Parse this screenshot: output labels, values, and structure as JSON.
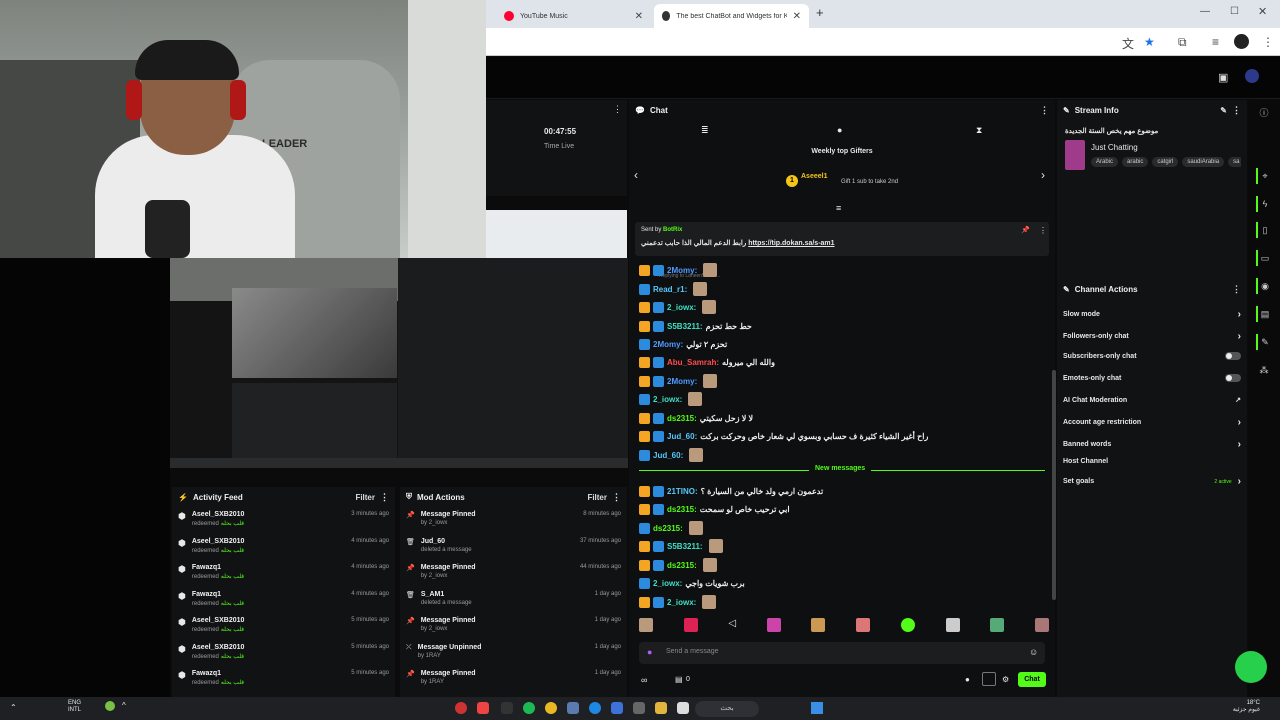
{
  "browser": {
    "tabs": [
      {
        "label": "YouTube Music",
        "active": false
      },
      {
        "label": "The best ChatBot and Widgets for Kick. Fe",
        "active": true
      }
    ],
    "new_tab": "+"
  },
  "timer": {
    "value": "00:47:55",
    "label": "Time Live"
  },
  "chat": {
    "title": "Chat",
    "gifters_title": "Weekly top Gifters",
    "gifter_rank": "1",
    "gifter_name": "Aseeel1",
    "gifter_note": "Gift 1 sub to take 2nd",
    "pinned_by_label": "Sent by",
    "pinned_by_name": "BotRix",
    "pinned_text": "رابط الدعم المالي الذا حابب تدعمني",
    "pinned_link": "https://tip.dokan.sa/s-am1",
    "reply_note": "Replying to Laneen5890: ...",
    "new_messages": "New messages",
    "messages": [
      {
        "user": "2Momy:",
        "text": "",
        "cls": "u-blue"
      },
      {
        "user": "Read_r1:",
        "text": "",
        "cls": "u-cyan"
      },
      {
        "user": "2_iowx:",
        "text": "",
        "cls": "u-teal"
      },
      {
        "user": "S5B3211:",
        "text": "حط حط تحزم",
        "cls": "u-teal"
      },
      {
        "user": "2Momy:",
        "text": "تحزم ٢ تولي",
        "cls": "u-blue"
      },
      {
        "user": "Abu_Samrah:",
        "text": "والله الي ميروله",
        "cls": "u-red"
      },
      {
        "user": "2Momy:",
        "text": "",
        "cls": "u-blue"
      },
      {
        "user": "2_iowx:",
        "text": "",
        "cls": "u-teal"
      },
      {
        "user": "ds2315:",
        "text": "لا لا زحل سكيتي",
        "cls": "u-green"
      },
      {
        "user": "Jud_60:",
        "text": "راح أغير الشياء كثيرة ف حسابي وبسوي لي شعار خاص وحركت بركت",
        "cls": "u-cyan"
      },
      {
        "user": "Jud_60:",
        "text": "",
        "cls": "u-cyan"
      },
      {
        "user": "21TINO:",
        "text": "تدعمون ارمي ولد خالي من السيارة ؟",
        "cls": "u-cyan"
      },
      {
        "user": "ds2315:",
        "text": "ابي ترحيب خاص لو سمحت",
        "cls": "u-green"
      },
      {
        "user": "ds2315:",
        "text": "",
        "cls": "u-green"
      },
      {
        "user": "S5B3211:",
        "text": "",
        "cls": "u-teal"
      },
      {
        "user": "ds2315:",
        "text": "",
        "cls": "u-green"
      },
      {
        "user": "2_iowx:",
        "text": "برب شويات واجي",
        "cls": "u-teal"
      },
      {
        "user": "2_iowx:",
        "text": "",
        "cls": "u-teal"
      }
    ],
    "input_placeholder": "Send a message",
    "points": "0",
    "send_label": "Chat"
  },
  "stream_info": {
    "title": "Stream Info",
    "stream_title": "موضوع مهم يخص الستة الجديدة",
    "category": "Just Chatting",
    "tags": [
      "Arabic",
      "arabic",
      "catgirl",
      "saudiArabia",
      "sa"
    ]
  },
  "channel_actions": {
    "title": "Channel Actions",
    "items": [
      {
        "label": "Slow mode",
        "control": "chevron"
      },
      {
        "label": "Followers-only chat",
        "control": "chevron"
      },
      {
        "label": "Subscribers-only chat",
        "control": "toggle"
      },
      {
        "label": "Emotes-only chat",
        "control": "toggle"
      },
      {
        "label": "AI Chat Moderation",
        "control": "link"
      },
      {
        "label": "Account age restriction",
        "control": "chevron"
      },
      {
        "label": "Banned words",
        "control": "chevron"
      },
      {
        "label": "Host Channel",
        "control": "none"
      },
      {
        "label": "Set goals",
        "control": "chevron"
      }
    ],
    "goals_badge": "2 active"
  },
  "activity_feed": {
    "title": "Activity Feed",
    "filter": "Filter",
    "items": [
      {
        "name": "Aseel_SXB2010",
        "action": "redeemed",
        "reward": "قلب بحله",
        "time": "3 minutes ago"
      },
      {
        "name": "Aseel_SXB2010",
        "action": "redeemed",
        "reward": "قلب بحله",
        "time": "4 minutes ago"
      },
      {
        "name": "Fawazq1",
        "action": "redeemed",
        "reward": "قلب بحله",
        "time": "4 minutes ago"
      },
      {
        "name": "Fawazq1",
        "action": "redeemed",
        "reward": "قلب بحله",
        "time": "4 minutes ago"
      },
      {
        "name": "Aseel_SXB2010",
        "action": "redeemed",
        "reward": "قلب بحله",
        "time": "5 minutes ago"
      },
      {
        "name": "Aseel_SXB2010",
        "action": "redeemed",
        "reward": "قلب بحله",
        "time": "5 minutes ago"
      },
      {
        "name": "Fawazq1",
        "action": "redeemed",
        "reward": "قلب بحله",
        "time": "5 minutes ago"
      }
    ]
  },
  "mod_actions": {
    "title": "Mod Actions",
    "filter": "Filter",
    "items": [
      {
        "name": "Message Pinned",
        "sub": "by 2_iowx",
        "time": "8 minutes ago",
        "icon": "pin"
      },
      {
        "name": "Jud_60",
        "sub": "deleted a message",
        "time": "37 minutes ago",
        "icon": "trash"
      },
      {
        "name": "Message Pinned",
        "sub": "by 2_iowx",
        "time": "44 minutes ago",
        "icon": "pin"
      },
      {
        "name": "S_AM1",
        "sub": "deleted a message",
        "time": "1 day ago",
        "icon": "trash"
      },
      {
        "name": "Message Pinned",
        "sub": "by 2_iowx",
        "time": "1 day ago",
        "icon": "pin"
      },
      {
        "name": "Message Unpinned",
        "sub": "by 1RAY",
        "time": "1 day ago",
        "icon": "unpin"
      },
      {
        "name": "Message Pinned",
        "sub": "by 1RAY",
        "time": "1 day ago",
        "icon": "pin"
      }
    ]
  },
  "taskbar": {
    "lang1": "ENG",
    "lang2": "INTL",
    "search": "بحث",
    "weather": "18°C",
    "clock": "غيوم جزئية"
  }
}
